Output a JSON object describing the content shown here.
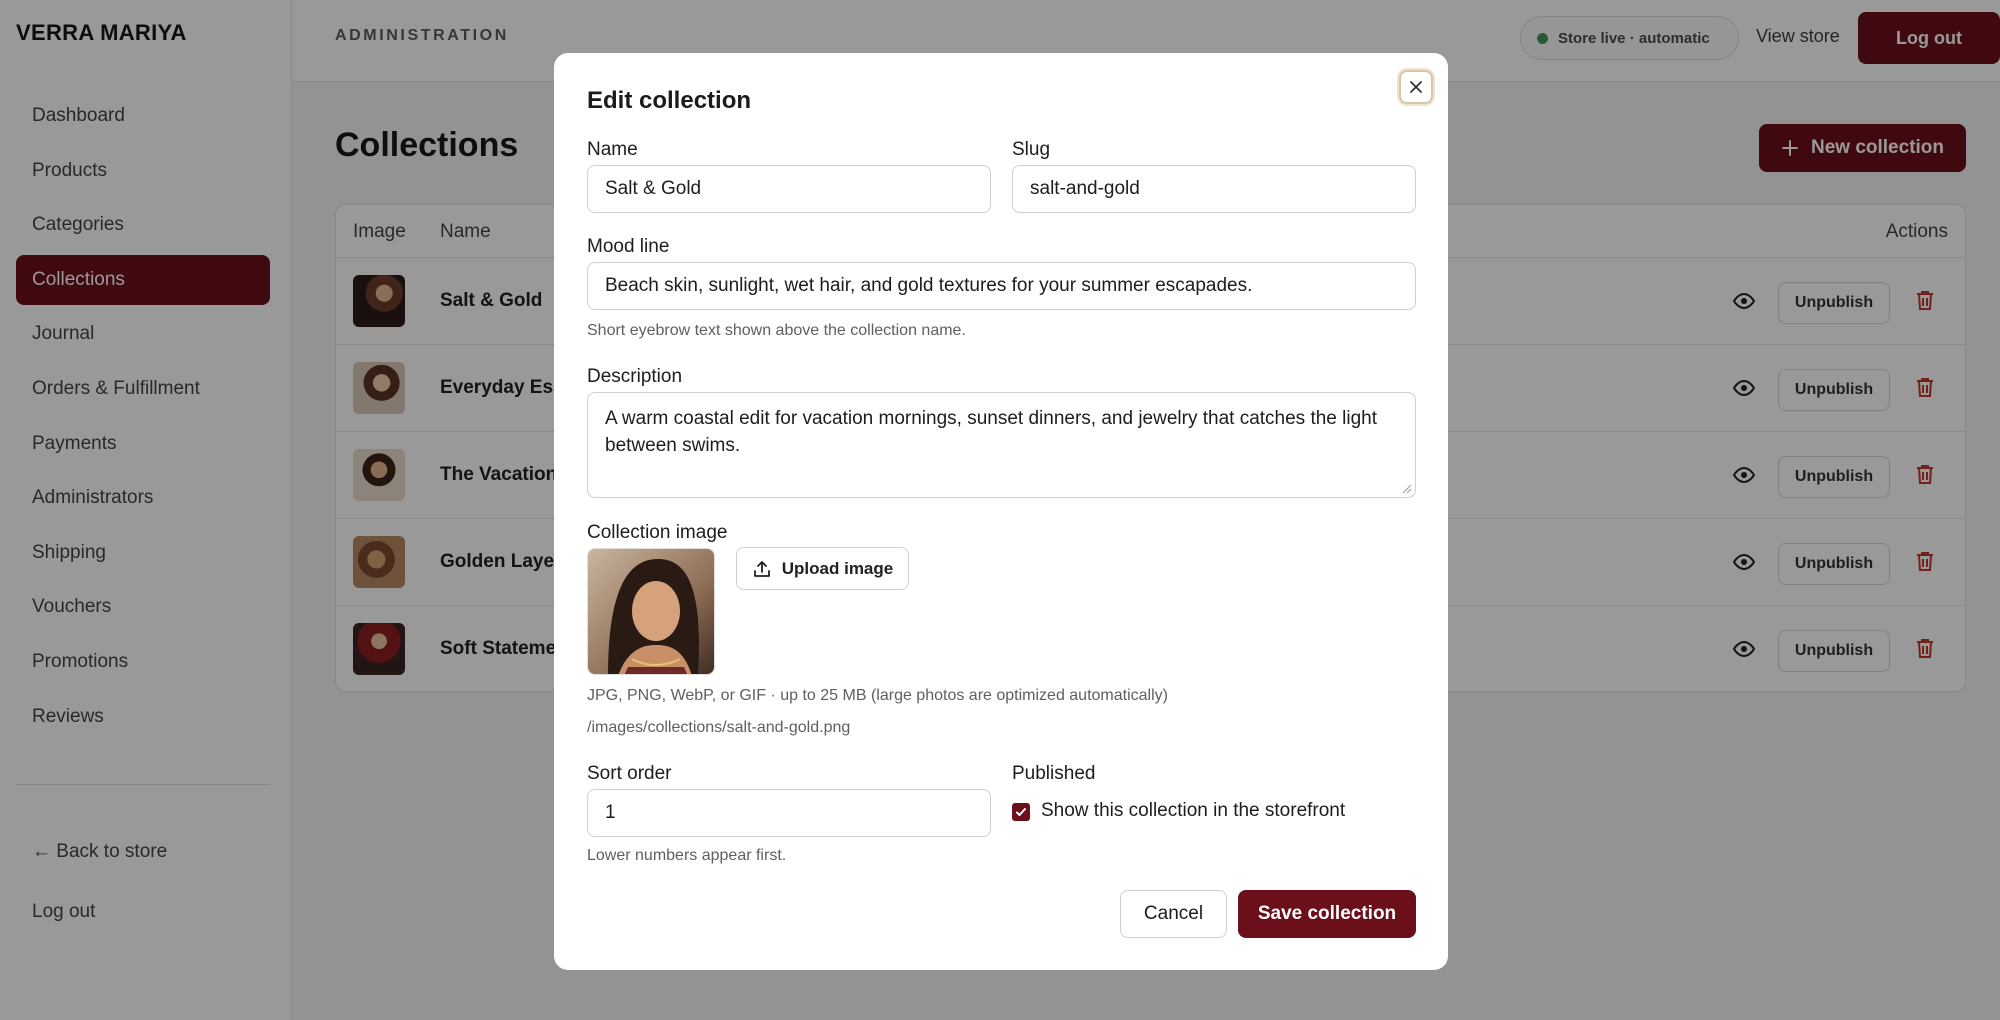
{
  "sidebar": {
    "brand": "VERRA MARIYA",
    "items": [
      {
        "label": "Dashboard"
      },
      {
        "label": "Products"
      },
      {
        "label": "Categories"
      },
      {
        "label": "Collections"
      },
      {
        "label": "Journal"
      },
      {
        "label": "Orders & Fulfillment"
      },
      {
        "label": "Payments"
      },
      {
        "label": "Administrators"
      },
      {
        "label": "Shipping"
      },
      {
        "label": "Vouchers"
      },
      {
        "label": "Promotions"
      },
      {
        "label": "Reviews"
      }
    ],
    "active_item": "Collections",
    "back_to_store": "← Back to store",
    "log_out": "Log out"
  },
  "header": {
    "section": "ADMINISTRATION",
    "store_status": "Store live · automatic",
    "view_store": "View store",
    "log_out": "Log out"
  },
  "main": {
    "title": "Collections",
    "new_button": "New collection",
    "table": {
      "columns": {
        "image": "Image",
        "name": "Name",
        "actions": "Actions"
      },
      "rows": [
        {
          "name": "Salt & Gold",
          "action": "Unpublish"
        },
        {
          "name": "Everyday Ess",
          "action": "Unpublish"
        },
        {
          "name": "The Vacation",
          "action": "Unpublish"
        },
        {
          "name": "Golden Layer",
          "action": "Unpublish"
        },
        {
          "name": "Soft Stateme",
          "action": "Unpublish"
        }
      ]
    }
  },
  "modal": {
    "title": "Edit collection",
    "name_label": "Name",
    "name_value": "Salt & Gold",
    "slug_label": "Slug",
    "slug_value": "salt-and-gold",
    "mood_label": "Mood line",
    "mood_value": "Beach skin, sunlight, wet hair, and gold textures for your summer escapades.",
    "mood_hint": "Short eyebrow text shown above the collection name.",
    "description_label": "Description",
    "description_value": "A warm coastal edit for vacation mornings, sunset dinners, and jewelry that catches the light between swims.",
    "image_label": "Collection image",
    "upload_button": "Upload image",
    "image_hint": "JPG, PNG, WebP, or GIF · up to 25 MB (large photos are optimized automatically)",
    "image_path": "/images/collections/salt-and-gold.png",
    "sort_label": "Sort order",
    "sort_value": "1",
    "sort_hint": "Lower numbers appear first.",
    "published_label": "Published",
    "published_checked": true,
    "published_checkbox_label": "Show this collection in the storefront",
    "cancel_button": "Cancel",
    "save_button": "Save collection"
  },
  "colors": {
    "accent": "#6b0f1a",
    "status_dot": "#3f9a5a",
    "danger": "#c0392b"
  }
}
